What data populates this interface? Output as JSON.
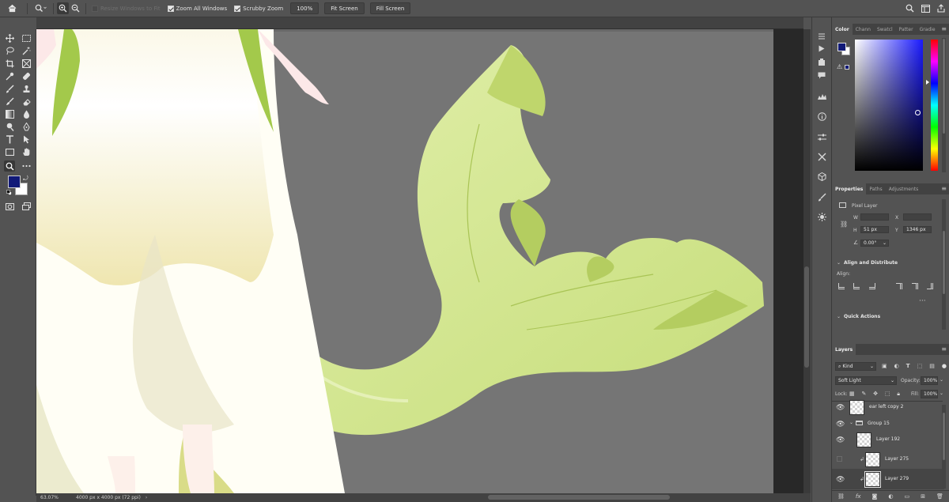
{
  "options_bar": {
    "resize_windows": "Resize Windows to Fit",
    "zoom_all": "Zoom All Windows",
    "scrubby": "Scrubby Zoom",
    "btn_100": "100%",
    "fit_screen": "Fit Screen",
    "fill_screen": "Fill Screen",
    "resize_checked": false,
    "zoom_all_checked": true,
    "scrubby_checked": true
  },
  "colors": {
    "foreground": "#111a78",
    "background": "#ffffff",
    "accent": "#1473e6",
    "fin_light": "#d7e89c",
    "fin_dark": "#b6cf63",
    "dress": "#fdfdf3"
  },
  "status_bar": {
    "zoom": "63.07%",
    "doc_info": "4000 px x 4000 px (72 ppi)"
  },
  "color_panel": {
    "tabs": [
      "Color",
      "Chann",
      "Swatcl",
      "Patter",
      "Gradie"
    ],
    "active_tab": "Color"
  },
  "properties_panel": {
    "tabs": [
      "Properties",
      "Paths",
      "Adjustments"
    ],
    "layer_type": "Pixel Layer",
    "w_label": "W",
    "x_label": "X",
    "h_label": "H",
    "h_value": "51 px",
    "y_label": "Y",
    "y_value": "1346 px",
    "angle": "0.00°",
    "align_distribute": "Align and Distribute",
    "align_label": "Align:",
    "quick_actions": "Quick Actions"
  },
  "layers_panel": {
    "tab": "Layers",
    "filter_kind": "Kind",
    "blend_mode": "Soft Light",
    "opacity_label": "Opacity:",
    "opacity_value": "100%",
    "lock_label": "Lock:",
    "fill_label": "Fill:",
    "fill_value": "100%",
    "layers": [
      {
        "name": "ear left copy 2",
        "visible": true,
        "clipped": false,
        "selected": false
      },
      {
        "name": "Group 15",
        "visible": true,
        "group": true,
        "selected": false
      },
      {
        "name": "Layer 192",
        "visible": true,
        "clipped": false,
        "selected": false
      },
      {
        "name": "Layer 275",
        "visible": false,
        "clipped": true,
        "selected": false
      },
      {
        "name": "Layer 279",
        "visible": true,
        "clipped": true,
        "selected": true
      }
    ]
  }
}
